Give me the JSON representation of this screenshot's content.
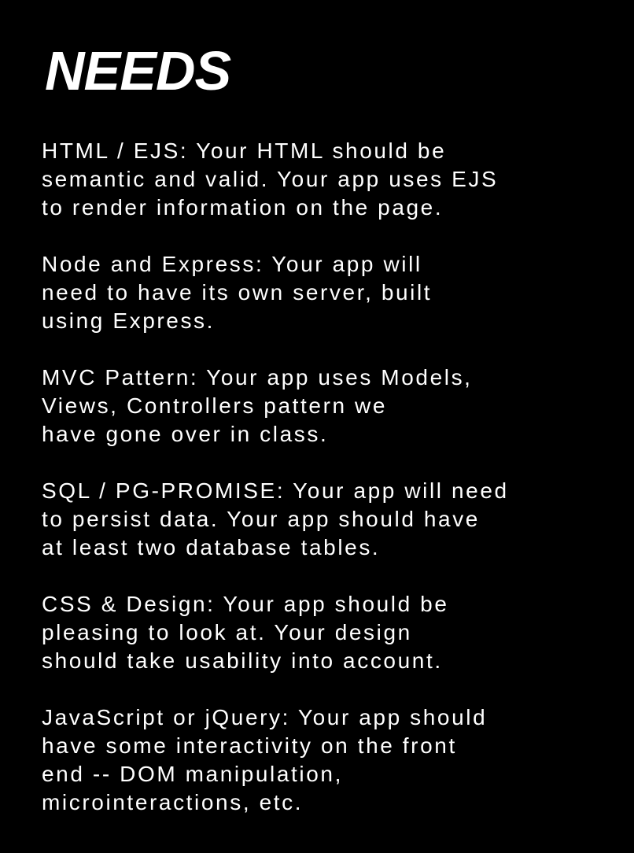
{
  "slide": {
    "title": "NEEDS",
    "sections": [
      {
        "lines": [
          "HTML / EJS: Your HTML should be",
          "semantic and valid. Your app uses EJS",
          "to render information on the page."
        ]
      },
      {
        "lines": [
          "Node and Express: Your app will",
          "need to have its own server, built",
          "using Express."
        ]
      },
      {
        "lines": [
          "MVC Pattern: Your app uses Models,",
          "Views, Controllers pattern we",
          "have gone over in class."
        ]
      },
      {
        "lines": [
          "SQL / PG-PROMISE: Your app will need",
          "to persist data. Your app should have",
          "at least two database tables."
        ]
      },
      {
        "lines": [
          "CSS & Design: Your app should be",
          "pleasing to look at. Your design",
          "should take usability into account."
        ]
      },
      {
        "lines": [
          "JavaScript or jQuery: Your app should",
          "have some interactivity on the front",
          "end -- DOM manipulation,",
          "microinteractions, etc."
        ]
      }
    ]
  },
  "colors": {
    "background": "#000000",
    "text": "#ffffff"
  }
}
